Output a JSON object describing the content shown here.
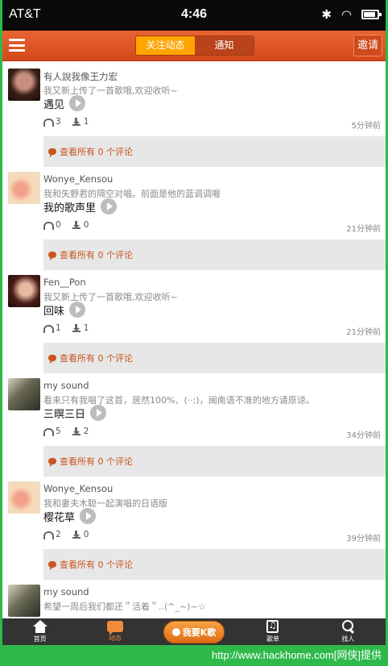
{
  "statusbar": {
    "carrier": "AT&T",
    "time": "4:46"
  },
  "topbar": {
    "tabs": [
      "关注动态",
      "通知"
    ],
    "active_tab": 0,
    "invite": "邀请"
  },
  "feed": [
    {
      "user": "有人說我像王力宏",
      "desc": "我又新上传了一首歌哦,欢迎收听~",
      "title": "遇见",
      "plays": "3",
      "downloads": "1",
      "time": "5分钟前",
      "comments": "查看所有 0 个评论"
    },
    {
      "user": "Wonye_Kensou",
      "desc": "我和矢野君的隔空对唱。前面是他的蓝调调喔",
      "title": "我的歌声里",
      "plays": "0",
      "downloads": "0",
      "time": "21分钟前",
      "comments": "查看所有 0 个评论"
    },
    {
      "user": "Fen__Pon",
      "desc": "我又新上传了一首歌哦,欢迎收听~",
      "title": "回味",
      "plays": "1",
      "downloads": "1",
      "time": "21分钟前",
      "comments": "查看所有 0 个评论"
    },
    {
      "user": "my sound",
      "desc": "看来只有我唱了这首，居然100%、(··;)，闽南语不准的地方请原谅。",
      "title": "三暝三日",
      "plays": "5",
      "downloads": "2",
      "time": "34分钟前",
      "comments": "查看所有 0 个评论"
    },
    {
      "user": "Wonye_Kensou",
      "desc": "我和妻夫木聪一起演唱的日语版",
      "title": "樱花草",
      "plays": "2",
      "downloads": "0",
      "time": "39分钟前",
      "comments": "查看所有 0 个评论"
    },
    {
      "user": "my sound",
      "desc": "希望一周后我们都还＂活着＂..(^_~)~☆",
      "title": "",
      "plays": "",
      "downloads": "",
      "time": "",
      "comments": ""
    }
  ],
  "bottomnav": {
    "home": "首页",
    "activity": "动态",
    "ksong": "我要K歌",
    "songlist": "歌单",
    "find": "找人"
  },
  "footer": {
    "url": "http://www.hackhome.com[网侠]提供"
  },
  "colors": {
    "accent": "#d4481a",
    "active_tab": "#ffa500",
    "comment_text": "#c9541f",
    "footer_green": "#2fb94b"
  }
}
